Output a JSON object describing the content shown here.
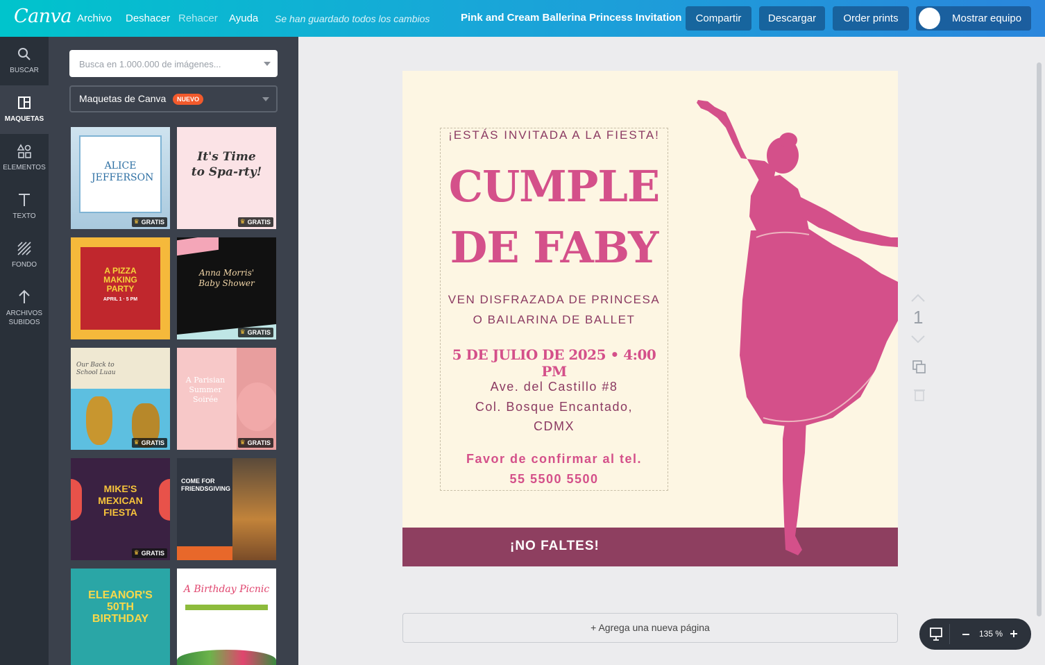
{
  "topbar": {
    "logo": "Canva",
    "menu": [
      "Archivo",
      "Deshacer",
      "Rehacer",
      "Ayuda"
    ],
    "saved_status": "Se han guardado todos los cambios",
    "doc_title": "Pink and Cream Ballerina Princess Invitation",
    "share": "Compartir",
    "download": "Descargar",
    "order_prints": "Order prints",
    "show_team": "Mostrar equipo"
  },
  "rail": {
    "items": [
      {
        "label": "BUSCAR",
        "icon": "search-icon"
      },
      {
        "label": "MAQUETAS",
        "icon": "layouts-icon"
      },
      {
        "label": "ELEMENTOS",
        "icon": "shapes-icon"
      },
      {
        "label": "TEXTO",
        "icon": "text-icon"
      },
      {
        "label": "FONDO",
        "icon": "background-icon"
      },
      {
        "label": "ARCHIVOS SUBIDOS",
        "icon": "upload-icon"
      }
    ]
  },
  "panel": {
    "search_placeholder": "Busca en 1.000.000 de imágenes...",
    "dropdown_label": "Maquetas de Canva",
    "new_badge": "NUEVO",
    "free_label": "GRATIS",
    "templates": [
      {
        "title": "ALICE JEFFERSON",
        "free": true
      },
      {
        "title": "It's Time to Spa-rty!",
        "free": true
      },
      {
        "title": "A PIZZA MAKING PARTY",
        "subtitle": "APRIL 1 · 5 PM",
        "free": false
      },
      {
        "title": "Anna Morris' Baby Shower",
        "free": true
      },
      {
        "title": "Our Back to School Luau",
        "free": true
      },
      {
        "title": "A Parisian Summer Soirée",
        "free": true
      },
      {
        "title": "MIKE'S MEXICAN FIESTA",
        "free": true
      },
      {
        "title": "COME FOR FRIENDSGIVING",
        "free": false
      },
      {
        "title": "ELEANOR'S 50TH BIRTHDAY",
        "free": false
      },
      {
        "title": "A Birthday Picnic",
        "free": false
      }
    ]
  },
  "invitation": {
    "line1": "¡ESTÁS INVITADA A LA FIESTA!",
    "title1": "CUMPLE",
    "title2": "DE FABY",
    "sub1": "VEN DISFRAZADA DE PRINCESA",
    "sub2": "O BAILARINA DE BALLET",
    "date": "5 DE JULIO DE 2025 • 4:00 PM",
    "addr1": "Ave. del Castillo #8",
    "addr2": "Col. Bosque Encantado,",
    "addr3": "CDMX",
    "rsvp1": "Favor de confirmar al tel.",
    "rsvp2": "55 5500 5500",
    "footer": "¡NO FALTES!"
  },
  "canvas": {
    "page_number": "1",
    "add_page": "+ Agrega una nueva página",
    "zoom": "135 %"
  },
  "colors": {
    "accent_pink": "#d4508a",
    "plum": "#8e3f60",
    "cream": "#fdf6e3"
  }
}
